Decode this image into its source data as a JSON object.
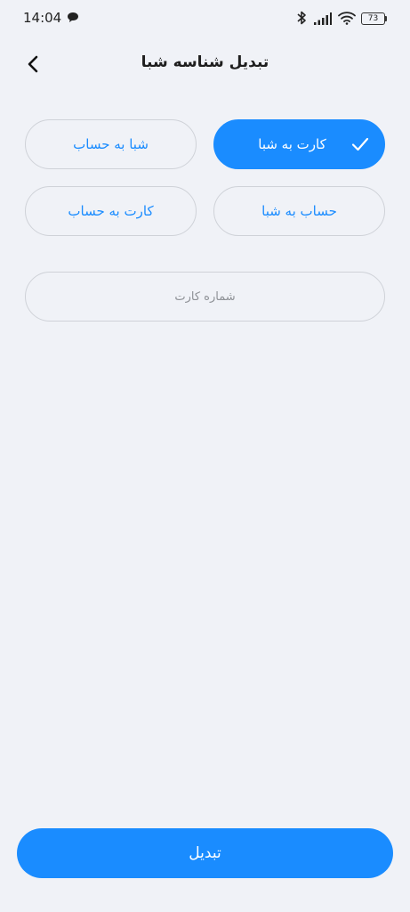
{
  "status_bar": {
    "time": "14:04",
    "battery": "73",
    "icons": [
      "chat-icon",
      "bluetooth-icon",
      "signal-icon",
      "wifi-icon",
      "battery-icon"
    ]
  },
  "header": {
    "title": "تبدیل شناسه شبا",
    "back_icon": "chevron-left-icon"
  },
  "options": {
    "card_to_sheba": "کارت به شبا",
    "sheba_to_account": "شبا به حساب",
    "account_to_sheba": "حساب به شبا",
    "card_to_account": "کارت به حساب",
    "selected": "card_to_sheba"
  },
  "card_input": {
    "placeholder": "شماره کارت",
    "value": ""
  },
  "submit": {
    "label": "تبدیل"
  },
  "colors": {
    "accent": "#1a8cff",
    "background": "#f0f2f7",
    "border": "#cfd2d8",
    "placeholder": "#8e9196"
  }
}
